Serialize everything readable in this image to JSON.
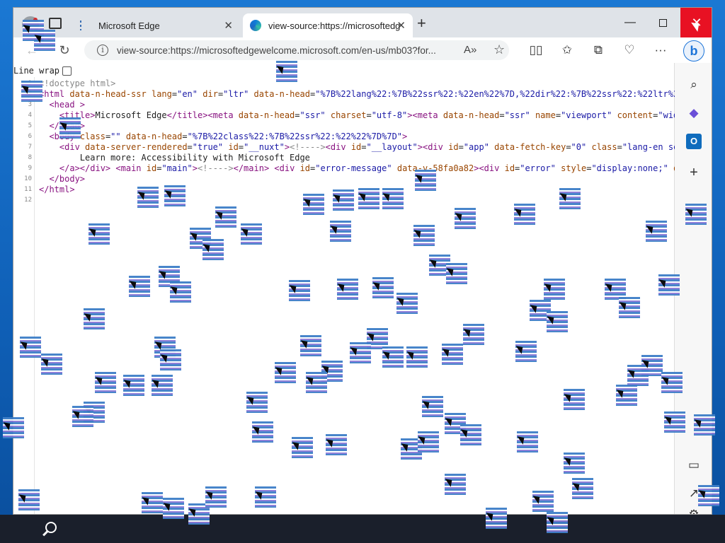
{
  "browser": {
    "tabs": [
      {
        "label": "Microsoft Edge",
        "close": "✕"
      },
      {
        "label": "view-source:https://microsoftedg",
        "close": "✕"
      }
    ],
    "new_tab_symbol": "+",
    "window_controls": {
      "minimize": "—",
      "maximize": "",
      "close": "✕"
    },
    "address": "view-source:https://microsoftedgewelcome.microsoft.com/en-us/mb03?for...",
    "read_aloud_label": "A⁾",
    "accent_color": "#0f6cbd",
    "close_color": "#e81123"
  },
  "view_source": {
    "line_wrap_label": "Line wrap",
    "line_wrap_checked": false,
    "lines": [
      {
        "n": "1",
        "html": "<span class=\"cmt\">&lt;!doctype html&gt;</span>"
      },
      {
        "n": "2",
        "html": "<span class=\"tag\">&lt;html</span> <span class=\"attr\">data-n-head-ssr</span> <span class=\"attr\">lang</span>=<span class=\"val\">\"en\"</span> <span class=\"attr\">dir</span>=<span class=\"val\">\"ltr\"</span> <span class=\"attr\">data-n-head</span>=<span class=\"val\">\"%7B%22lang%22:%7B%22ssr%22:%22en%22%7D,%22dir%22:%7B%22ssr%22:%22ltr%22</span>"
      },
      {
        "n": "3",
        "html": "  <span class=\"tag\">&lt;head &gt;</span>"
      },
      {
        "n": "4",
        "html": "    <span class=\"tag\">&lt;title&gt;</span>Microsoft Edge<span class=\"tag\">&lt;/title&gt;&lt;meta</span> <span class=\"attr\">data-n-head</span>=<span class=\"val\">\"ssr\"</span> <span class=\"attr\">charset</span>=<span class=\"val\">\"utf-8\"</span><span class=\"tag\">&gt;&lt;meta</span> <span class=\"attr\">data-n-head</span>=<span class=\"val\">\"ssr\"</span> <span class=\"attr\">name</span>=<span class=\"val\">\"viewport\"</span> <span class=\"attr\">content</span>=<span class=\"val\">\"widt</span>"
      },
      {
        "n": "5",
        "html": "  <span class=\"tag\">&lt;/head&gt;</span>"
      },
      {
        "n": "6",
        "html": "  <span class=\"tag\">&lt;body</span> <span class=\"attr\">class</span>=<span class=\"val\">\"\"</span> <span class=\"attr\">data-n-head</span>=<span class=\"val\">\"%7B%22class%22:%7B%22ssr%22:%22%22%7D%7D\"</span><span class=\"tag\">&gt;</span>"
      },
      {
        "n": "7",
        "html": "    <span class=\"tag\">&lt;div</span> <span class=\"attr\">data-server-rendered</span>=<span class=\"val\">\"true\"</span> <span class=\"attr\">id</span>=<span class=\"val\">\"__nuxt\"</span><span class=\"tag\">&gt;</span><span class=\"cmt\">&lt;!----&gt;</span><span class=\"tag\">&lt;div</span> <span class=\"attr\">id</span>=<span class=\"val\">\"__layout\"</span><span class=\"tag\">&gt;&lt;div</span> <span class=\"attr\">id</span>=<span class=\"val\">\"app\"</span> <span class=\"attr\">data-fetch-key</span>=<span class=\"val\">\"0\"</span> <span class=\"attr\">class</span>=<span class=\"val\">\"lang-en sec</span>"
      },
      {
        "n": "8",
        "html": "        Learn more: Accessibility with Microsoft Edge"
      },
      {
        "n": "9",
        "html": "    <span class=\"tag\">&lt;/a&gt;&lt;/div&gt;</span> <span class=\"tag\">&lt;main</span> <span class=\"attr\">id</span>=<span class=\"val\">\"main\"</span><span class=\"tag\">&gt;</span><span class=\"cmt\">&lt;!----&gt;</span><span class=\"tag\">&lt;/main&gt;</span> <span class=\"tag\">&lt;div</span> <span class=\"attr\">id</span>=<span class=\"val\">\"error-message\"</span> <span class=\"attr\">data-v-58fa0a82</span><span class=\"tag\">&gt;&lt;div</span> <span class=\"attr\">id</span>=<span class=\"val\">\"error\"</span> <span class=\"attr\">style</span>=<span class=\"val\">\"display:none;\"</span> <span class=\"attr\">da</span>"
      },
      {
        "n": "10",
        "html": "  <span class=\"tag\">&lt;/body&gt;</span>"
      },
      {
        "n": "11",
        "html": "<span class=\"tag\">&lt;/html&gt;</span>"
      },
      {
        "n": "12",
        "html": ""
      }
    ]
  },
  "sidebar": {
    "icons": [
      "search-icon",
      "copilot-icon",
      "outlook-icon",
      "add-icon",
      "sidebar-layout-icon",
      "external-link-icon",
      "settings-icon"
    ],
    "outlook_letter": "O"
  },
  "taskbar": {
    "icons": [
      "search-icon"
    ]
  }
}
